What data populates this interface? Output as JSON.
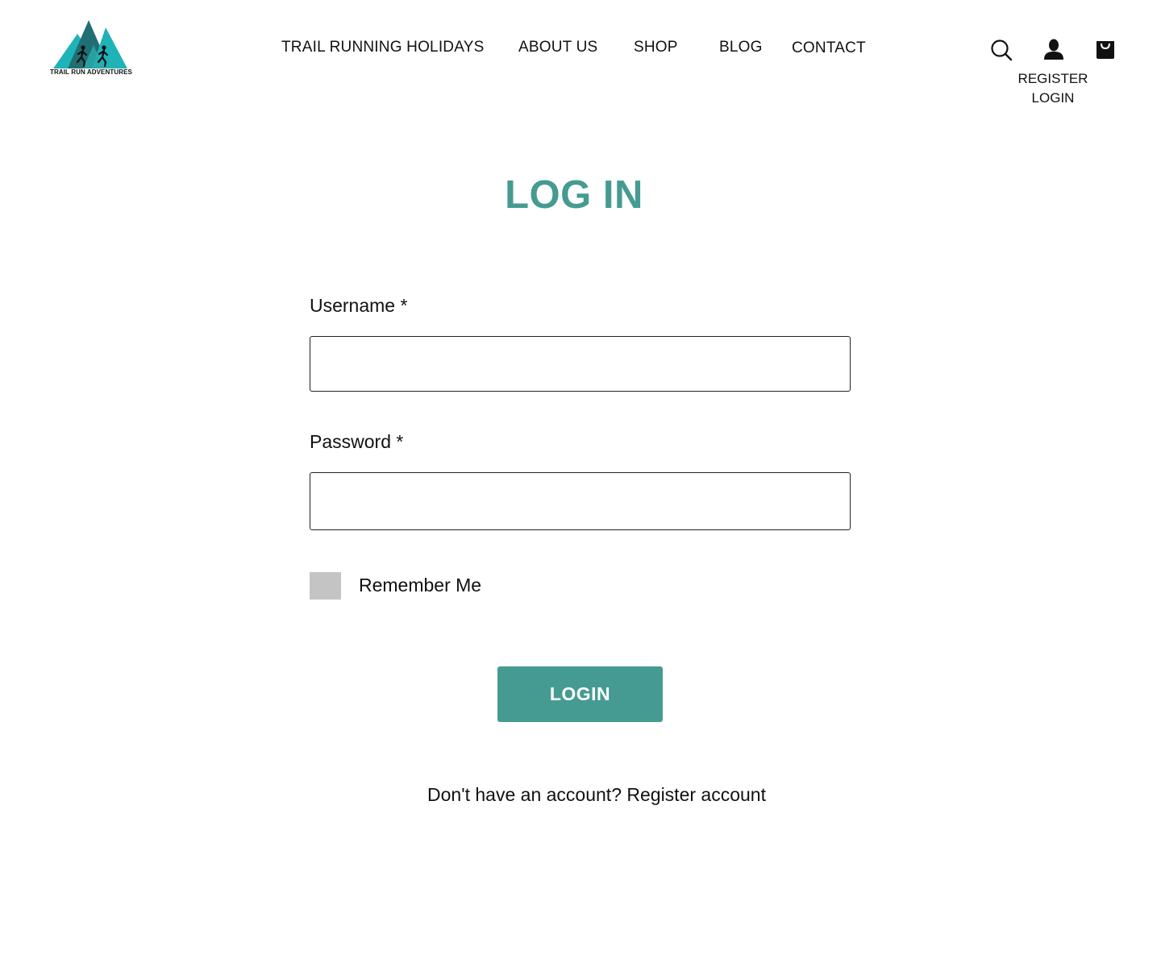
{
  "header": {
    "logo_text": "TRAIL RUN ADVENTURES",
    "nav": [
      {
        "label": "TRAIL RUNNING HOLIDAYS"
      },
      {
        "label": "ABOUT US"
      },
      {
        "label": "SHOP"
      },
      {
        "label": "BLOG"
      },
      {
        "label": "CONTACT"
      }
    ],
    "icons": {
      "search": "search-icon",
      "user": "user-icon",
      "cart": "shopping-bag-icon"
    },
    "account": {
      "register": "REGISTER",
      "login": "LOGIN"
    }
  },
  "main": {
    "title": "LOG IN",
    "username": {
      "label": "Username *",
      "value": ""
    },
    "password": {
      "label": "Password *",
      "value": ""
    },
    "remember": {
      "label": "Remember Me",
      "checked": false
    },
    "login_button": "LOGIN",
    "register_prompt": "Don't have an account?",
    "register_link": "Register account"
  },
  "colors": {
    "accent": "#459b91",
    "logo_dark": "#1f6f73",
    "logo_light": "#1fb3b8",
    "checkbox": "#c4c4c4",
    "text": "#111111",
    "background": "#ffffff"
  }
}
